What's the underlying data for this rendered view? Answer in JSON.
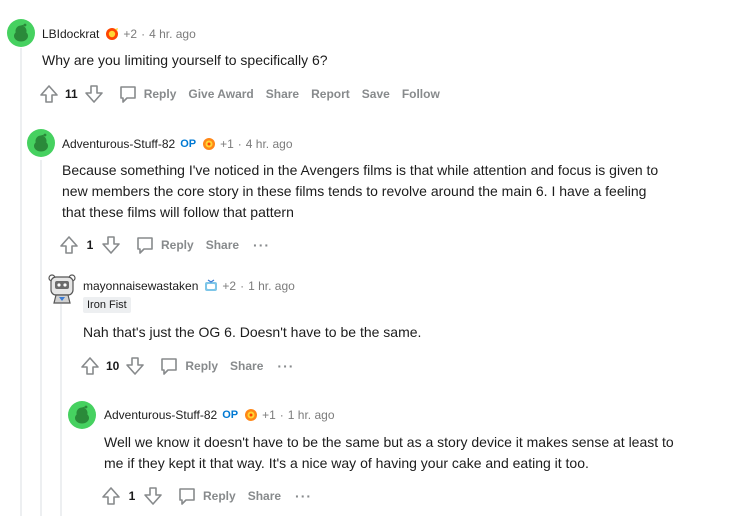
{
  "comments": [
    {
      "username": "LBIdockrat",
      "award_count": "+2",
      "separator": "·",
      "time": "4 hr. ago",
      "body": "Why are you limiting yourself to specifically 6?",
      "score": "11",
      "actions": {
        "reply": "Reply",
        "give_award": "Give Award",
        "share": "Share",
        "report": "Report",
        "save": "Save",
        "follow": "Follow"
      }
    },
    {
      "username": "Adventurous-Stuff-82",
      "op_badge": "OP",
      "award_count": "+1",
      "separator": "·",
      "time": "4 hr. ago",
      "body_lines": [
        "Because something I've noticed in the Avengers films is that while attention and focus is given to",
        "new members the core story in these films tends to revolve around the main 6. I have a feeling",
        "that these films will follow that pattern"
      ],
      "score": "1",
      "actions": {
        "reply": "Reply",
        "share": "Share",
        "more": "···"
      }
    },
    {
      "username": "mayonnaisewastaken",
      "award_count": "+2",
      "separator": "·",
      "time": "1 hr. ago",
      "flair": "Iron Fist",
      "body": "Nah that's just the OG 6. Doesn't have to be the same.",
      "score": "10",
      "actions": {
        "reply": "Reply",
        "share": "Share",
        "more": "···"
      }
    },
    {
      "username": "Adventurous-Stuff-82",
      "op_badge": "OP",
      "award_count": "+1",
      "separator": "·",
      "time": "1 hr. ago",
      "body_lines": [
        "Well we know it doesn't have to be the same but as a story device it makes sense at least to",
        "me if they kept it that way. It's a nice way of having your cake and eating it too."
      ],
      "score": "1",
      "actions": {
        "reply": "Reply",
        "share": "Share",
        "more": "···"
      }
    }
  ],
  "colors": {
    "avatar_green": "#46d160",
    "op_blue": "#0079d3",
    "muted": "#7c7c7c",
    "action_gray": "#878a8c",
    "thread_line": "#edeff1"
  },
  "icons": [
    "snoo-avatar-icon",
    "robot-avatar-icon",
    "award-icon",
    "upvote-icon",
    "downvote-icon",
    "comment-bubble-icon"
  ]
}
